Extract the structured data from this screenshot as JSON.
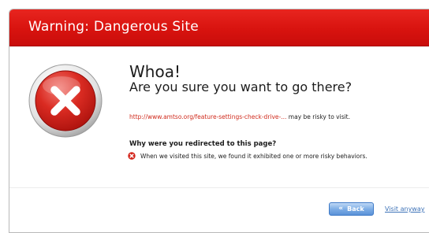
{
  "titlebar": {
    "title": "Warning: Dangerous Site"
  },
  "main": {
    "heading": "Whoa!",
    "subheading": "Are you sure you want to go there?",
    "url": "http://www.amtso.org/feature-settings-check-drive-...",
    "url_suffix": "may be risky to visit.",
    "question": "Why were you redirected to this page?",
    "reason": "When we visited this site, we found it exhibited one or more risky behaviors."
  },
  "footer": {
    "back_label": "Back",
    "visit_label": "Visit anyway"
  },
  "icons": {
    "warning": "x-circle-icon",
    "reason": "error-icon",
    "back": "double-chevron-left-icon"
  },
  "colors": {
    "titlebar": "#d8130f",
    "url": "#d02a1c",
    "link": "#3e73b8",
    "button": "#5b92d8"
  }
}
